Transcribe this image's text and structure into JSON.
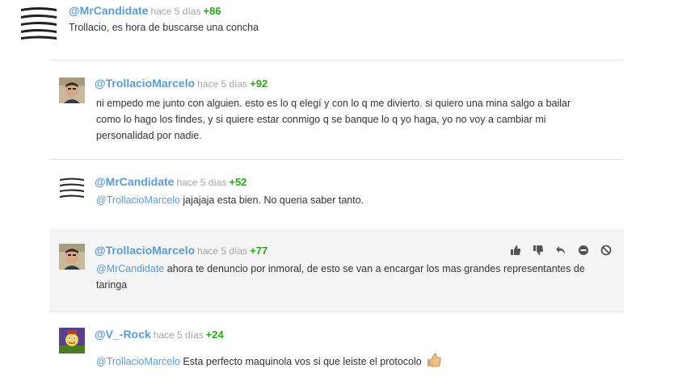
{
  "comments": [
    {
      "user": "@MrCandidate",
      "time": "hace 5 días",
      "score": "+86",
      "text": "Trollacio, es hora de buscarse una concha",
      "avatar_icon": "striped-logo-avatar"
    },
    {
      "user": "@TrollacioMarcelo",
      "time": "hace 5 días",
      "score": "+92",
      "text": "ni empedo me junto con alguien. esto es lo q elegí y con lo q me divierto. si quiero una mina salgo a bailar como lo hago los findes, y si quiere estar conmigo q se banque lo q yo haga, yo no voy a cambiar mi personalidad por nadie.",
      "avatar_icon": "user-photo-avatar"
    },
    {
      "user": "@MrCandidate",
      "time": "hace 5 días",
      "score": "+52",
      "mention": "@TrollacioMarcelo",
      "text": " jajajaja esta bien. No queria saber tanto.",
      "avatar_icon": "striped-logo-avatar"
    },
    {
      "user": "@TrollacioMarcelo",
      "time": "hace 5 días",
      "score": "+77",
      "mention": "@MrCandidate",
      "text": " ahora te denuncio por inmoral, de esto se van a encargar los mas grandes representantes de taringa",
      "avatar_icon": "user-photo-avatar",
      "actions": [
        "thumbs-up-icon",
        "thumbs-down-icon",
        "reply-icon",
        "minus-circle-icon",
        "block-icon"
      ]
    },
    {
      "user": "@V_-Rock",
      "time": "hace 5 días",
      "score": "+24",
      "mention": "@TrollacioMarcelo",
      "text": " Esta perfecto maquinola vos si que leiste el protocolo",
      "avatar_icon": "cartoon-avatar",
      "emoji": "thumbs-up-emoji"
    }
  ],
  "colors": {
    "username": "#5b9bd1",
    "score": "#27a61a",
    "time": "#a3a3a3",
    "text": "#333333",
    "highlight": "#f5f5f5"
  }
}
